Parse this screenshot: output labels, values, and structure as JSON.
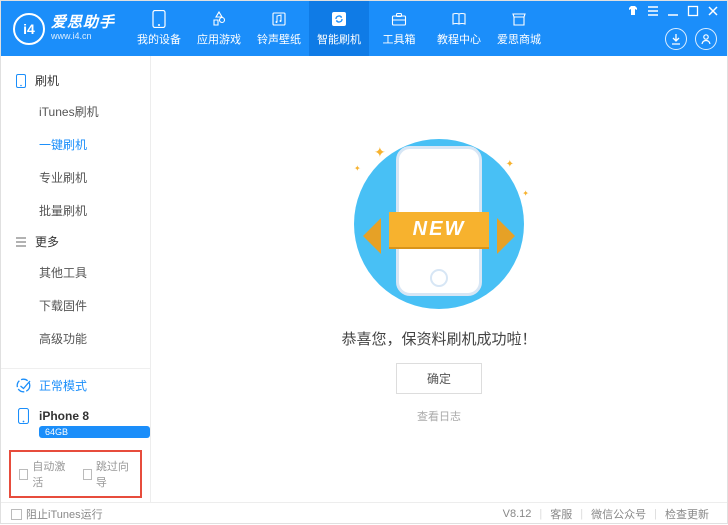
{
  "app": {
    "logo_badge": "i4",
    "logo_title": "爱思助手",
    "logo_sub": "www.i4.cn"
  },
  "nav": [
    {
      "label": "我的设备",
      "icon": "phone"
    },
    {
      "label": "应用游戏",
      "icon": "apps"
    },
    {
      "label": "铃声壁纸",
      "icon": "music"
    },
    {
      "label": "智能刷机",
      "icon": "refresh",
      "active": true
    },
    {
      "label": "工具箱",
      "icon": "toolbox"
    },
    {
      "label": "教程中心",
      "icon": "book"
    },
    {
      "label": "爱思商城",
      "icon": "store"
    }
  ],
  "sidebar": {
    "group1": {
      "label": "刷机"
    },
    "items1": [
      "iTunes刷机",
      "一键刷机",
      "专业刷机",
      "批量刷机"
    ],
    "active1": 1,
    "group2": {
      "label": "更多"
    },
    "items2": [
      "其他工具",
      "下载固件",
      "高级功能"
    ],
    "mode": {
      "label": "正常模式"
    },
    "device": {
      "name": "iPhone 8",
      "storage": "64GB"
    },
    "checks": {
      "auto_activate": "自动激活",
      "skip_guide": "跳过向导"
    }
  },
  "main": {
    "ribbon": "NEW",
    "success": "恭喜您，保资料刷机成功啦！",
    "ok": "确定",
    "view_log": "查看日志"
  },
  "footer": {
    "block_itunes": "阻止iTunes运行",
    "version": "V8.12",
    "support": "客服",
    "wechat": "微信公众号",
    "check_update": "检查更新"
  }
}
